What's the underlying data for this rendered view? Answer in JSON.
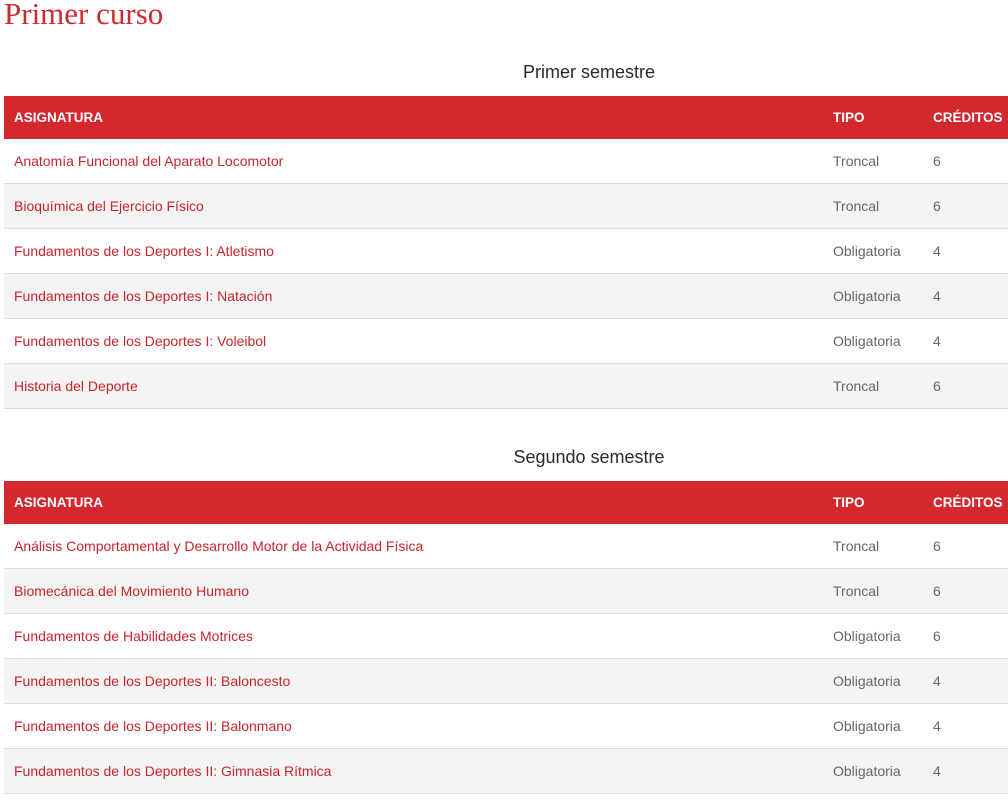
{
  "page": {
    "title": "Primer curso"
  },
  "headers": {
    "subject": "ASIGNATURA",
    "type": "TIPO",
    "credits": "CRÉDITOS"
  },
  "semesters": [
    {
      "title": "Primer semestre",
      "rows": [
        {
          "subject": "Anatomía Funcional del Aparato Locomotor",
          "type": "Troncal",
          "credits": "6"
        },
        {
          "subject": "Bioquímica del Ejercicio Físico",
          "type": "Troncal",
          "credits": "6"
        },
        {
          "subject": "Fundamentos de los Deportes I: Atletismo",
          "type": "Obligatoria",
          "credits": "4"
        },
        {
          "subject": "Fundamentos de los Deportes I: Natación",
          "type": "Obligatoria",
          "credits": "4"
        },
        {
          "subject": "Fundamentos de los Deportes I: Voleibol",
          "type": "Obligatoria",
          "credits": "4"
        },
        {
          "subject": "Historia del Deporte",
          "type": "Troncal",
          "credits": "6"
        }
      ]
    },
    {
      "title": "Segundo semestre",
      "rows": [
        {
          "subject": "Análisis Comportamental y Desarrollo Motor de la Actividad Física",
          "type": "Troncal",
          "credits": "6"
        },
        {
          "subject": "Biomecánica del Movimiento Humano",
          "type": "Troncal",
          "credits": "6"
        },
        {
          "subject": "Fundamentos de Habilidades Motrices",
          "type": "Obligatoria",
          "credits": "6"
        },
        {
          "subject": "Fundamentos de los Deportes II: Baloncesto",
          "type": "Obligatoria",
          "credits": "4"
        },
        {
          "subject": "Fundamentos de los Deportes II: Balonmano",
          "type": "Obligatoria",
          "credits": "4"
        },
        {
          "subject": "Fundamentos de los Deportes II: Gimnasia Rítmica",
          "type": "Obligatoria",
          "credits": "4"
        }
      ]
    }
  ],
  "colors": {
    "accent": "#d2282e",
    "link": "#c8252c",
    "row_alt": "#f4f4f4"
  }
}
